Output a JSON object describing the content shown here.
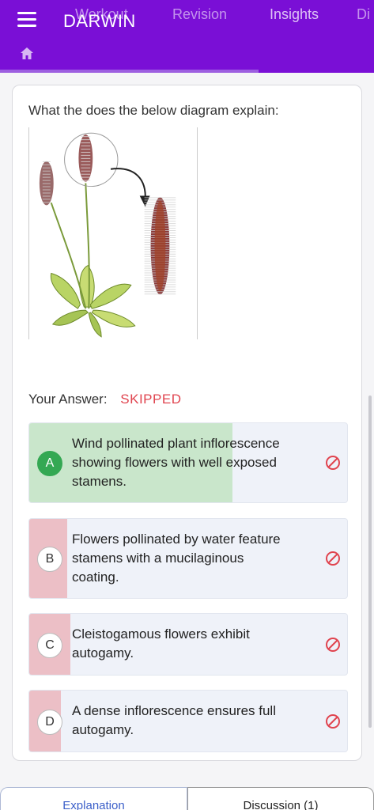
{
  "appbar": {
    "title": "DARWIN",
    "tabs": [
      "Workout",
      "Revision",
      "Insights",
      "Di"
    ],
    "active_tab": "Insights"
  },
  "question": {
    "text": "What the does the below diagram explain:",
    "your_answer_label": "Your Answer:",
    "your_answer_value": "SKIPPED"
  },
  "options": [
    {
      "letter": "A",
      "text": "Wind pollinated plant inflorescence showing flowers with well exposed stamens.",
      "status": "correct"
    },
    {
      "letter": "B",
      "text": "Flowers pollinated by water feature stamens with a mucilaginous coating.",
      "status": "incorrect"
    },
    {
      "letter": "C",
      "text": "Cleistogamous flowers exhibit autogamy.",
      "status": "incorrect"
    },
    {
      "letter": "D",
      "text": "A dense inflorescence ensures full autogamy.",
      "status": "incorrect"
    }
  ],
  "bottom_tabs": {
    "explanation": "Explanation",
    "discussion": "Discussion (1)"
  },
  "colors": {
    "appbar": "#7a0fd6",
    "correct": "#34a853",
    "correct_fill": "#c9e6cb",
    "incorrect_fill": "#ecbfc6",
    "skipped": "#e0444f",
    "accent": "#3b5fc9"
  },
  "icons": {
    "menu": "hamburger-icon",
    "home": "home-icon",
    "ban": "ban-icon"
  }
}
